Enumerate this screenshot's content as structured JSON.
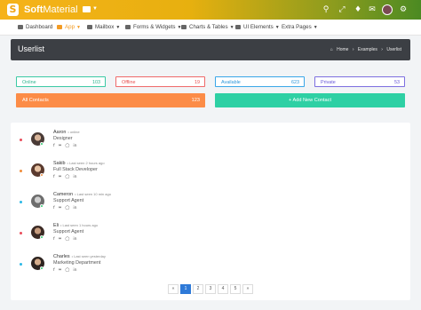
{
  "topbar": {
    "brand_bold": "Soft",
    "brand_light": "Material",
    "logo_letter": "S",
    "icons": [
      "search-icon",
      "expand-icon",
      "bell-icon",
      "message-icon",
      "settings-icon"
    ]
  },
  "nav": {
    "items": [
      {
        "label": "Dashboard",
        "active": false
      },
      {
        "label": "App",
        "active": true
      },
      {
        "label": "Mailbox",
        "active": false
      },
      {
        "label": "Forms & Widgets",
        "active": false
      },
      {
        "label": "Charts & Tables",
        "active": false
      },
      {
        "label": "UI Elements",
        "active": false
      },
      {
        "label": "Extra Pages",
        "active": false
      }
    ]
  },
  "header": {
    "title": "Userlist",
    "breadcrumbs": [
      "Home",
      "Examples",
      "Userlist"
    ]
  },
  "stats": {
    "online": {
      "label": "Online",
      "value": "103"
    },
    "offline": {
      "label": "Offline",
      "value": "19"
    },
    "available": {
      "label": "Available",
      "value": "623"
    },
    "private": {
      "label": "Private",
      "value": "53"
    }
  },
  "all_contacts": {
    "label": "All Contacts",
    "value": "123"
  },
  "add_contact_label": "+ Add New Contact",
  "contacts": [
    {
      "name": "Aaron",
      "meta": "• online",
      "role": "Designer",
      "color": "#e94b5a"
    },
    {
      "name": "Sakib",
      "meta": "• Last seen 2 hours ago",
      "role": "Full Stack Developer",
      "color": "#f08c3a"
    },
    {
      "name": "Cameron",
      "meta": "• Last seen 10 min ago",
      "role": "Support Agent",
      "color": "#2bb8e6"
    },
    {
      "name": "Eli",
      "meta": "• Last seen 1 hours ago",
      "role": "Support Agent",
      "color": "#e94b5a"
    },
    {
      "name": "Charles",
      "meta": "• Last seen yesterday",
      "role": "Marketing Department",
      "color": "#2bb8e6"
    }
  ],
  "pagination": [
    "«",
    "1",
    "2",
    "3",
    "4",
    "5",
    "»"
  ],
  "active_page": "1"
}
